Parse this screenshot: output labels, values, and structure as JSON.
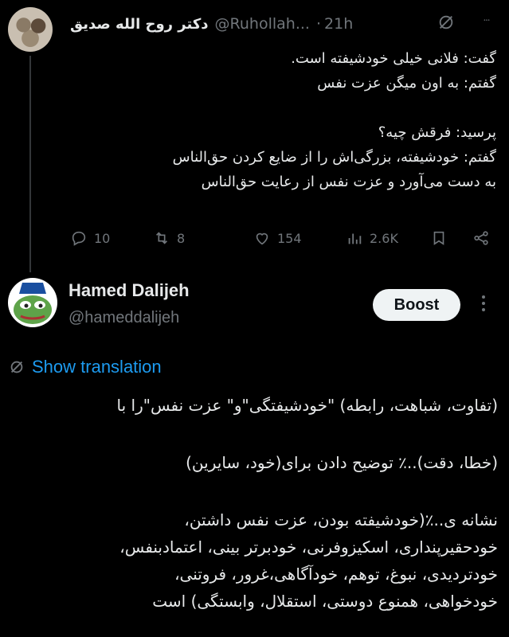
{
  "tweet1": {
    "author_name": "دکتر روح الله صدیق",
    "handle": "@Ruhollah...",
    "separator": "·",
    "time": "21h",
    "body_lines": [
      "گفت: فلانی خیلی خودشیفته است.",
      "گفتم: به اون میگن عزت نفس",
      "",
      "پرسید: فرقش چیه؟",
      "گفتم: خودشیفته، بزرگی‌اش را از ضایع کردن حق‌الناس",
      "به دست می‌آورد و عزت نفس از رعایت حق‌الناس"
    ],
    "actions": {
      "replies": "10",
      "reposts": "8",
      "likes": "154",
      "views": "2.6K"
    }
  },
  "tweet2": {
    "author_name": "Hamed Dalijeh",
    "handle": "@hameddalijeh",
    "boost_label": "Boost",
    "translate_label": "Show translation",
    "body": {
      "line1": "(تفاوت، شباهت، رابطه) \"خودشیفتگی\"و\" عزت نفس\"را با",
      "line2": "(خطا، دقت)..٪ توضیح دادن برای(خود، سایرین)",
      "line3": "نشانه ی..٪(خودشیفته بودن، عزت نفس داشتن،",
      "line4": "خودحقیرپنداری، اسکیزوفرنی، خودبرتر بینی، اعتمادبنفس،",
      "line5": "خودتردیدی، نبوغ، توهم، خودآگاهی،غرور، فروتنی،",
      "line6": "خودخواهی، همنوع دوستی، استقلال، وابستگی) است"
    }
  },
  "colors": {
    "background": "#000000",
    "text": "#e7e9ea",
    "muted": "#71767b",
    "link": "#1d9bf0",
    "button_bg": "#eff3f4"
  }
}
